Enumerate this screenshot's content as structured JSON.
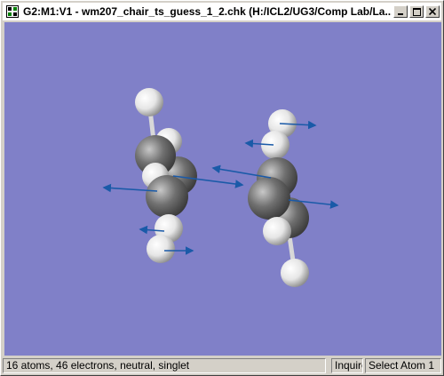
{
  "window": {
    "title": "G2:M1:V1 - wm207_chair_ts_guess_1_2.chk (H:/ICL2/UG3/Comp Lab/La..."
  },
  "title_buttons": {
    "minimize_icon": "minimize-icon",
    "maximize_icon": "maximize-icon",
    "close_icon": "close-icon"
  },
  "viewport": {
    "background_color": "#8080c8",
    "vector_color": "#1a5aa8",
    "carbon_color": "#707070",
    "hydrogen_color": "#f0f0f0"
  },
  "statusbar": {
    "summary": "16 atoms, 46 electrons, neutral, singlet",
    "mode": "Inquire",
    "action": "Select Atom 1"
  }
}
